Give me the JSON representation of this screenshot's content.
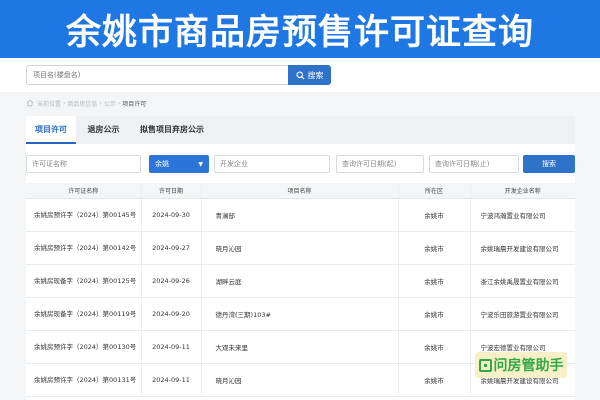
{
  "banner": {
    "title": "余姚市商品房预售许可证查询"
  },
  "search": {
    "placeholder": "项目名(楼盘名)",
    "button_label": "搜索"
  },
  "breadcrumb": {
    "items": [
      "当前位置",
      "商品房信息",
      "公示",
      "项目许可"
    ]
  },
  "tabs": [
    {
      "label": "项目许可",
      "active": true
    },
    {
      "label": "退房公示",
      "active": false
    },
    {
      "label": "拟售项目弃房公示",
      "active": false
    }
  ],
  "filters": {
    "permit_placeholder": "许可证名称",
    "district_value": "余姚",
    "developer_placeholder": "开发企业",
    "date_start_placeholder": "查询许可日期(起)",
    "date_end_placeholder": "查询许可日期(止)",
    "search_label": "搜索"
  },
  "table": {
    "columns": [
      "许可证名称",
      "许可日期",
      "项目名称",
      "所在区",
      "开发企业名称"
    ],
    "rows": [
      {
        "permit": "余姚房预许字（2024）第00145号",
        "date": "2024-09-30",
        "project": "青澜邸",
        "district": "余姚市",
        "developer": "宁波鸿瀚置业有限公司"
      },
      {
        "permit": "余姚房预许字（2024）第00142号",
        "date": "2024-09-27",
        "project": "晓月沁园",
        "district": "余姚市",
        "developer": "余姚瑞晨开发建设有限公司"
      },
      {
        "permit": "余姚房现备字（2024）第00125号",
        "date": "2024-09-26",
        "project": "湖畔云庭",
        "district": "余姚市",
        "developer": "浙江余姚禹晟置业有限公司"
      },
      {
        "permit": "余姚房现备字（2024）第00119号",
        "date": "2024-09-20",
        "project": "德丹湾(三期)103#",
        "district": "余姚市",
        "developer": "宁波乐田旅游置业有限公司"
      },
      {
        "permit": "余姚房预许字（2024）第00130号",
        "date": "2024-09-11",
        "project": "大观未来里",
        "district": "余姚市",
        "developer": "宁波宏德置业有限公司"
      },
      {
        "permit": "余姚房预许字（2024）第00131号",
        "date": "2024-09-11",
        "project": "晓月沁园",
        "district": "余姚市",
        "developer": "余姚瑞晨开发建设有限公司"
      }
    ]
  },
  "watermark": {
    "text": "问房管助手"
  }
}
